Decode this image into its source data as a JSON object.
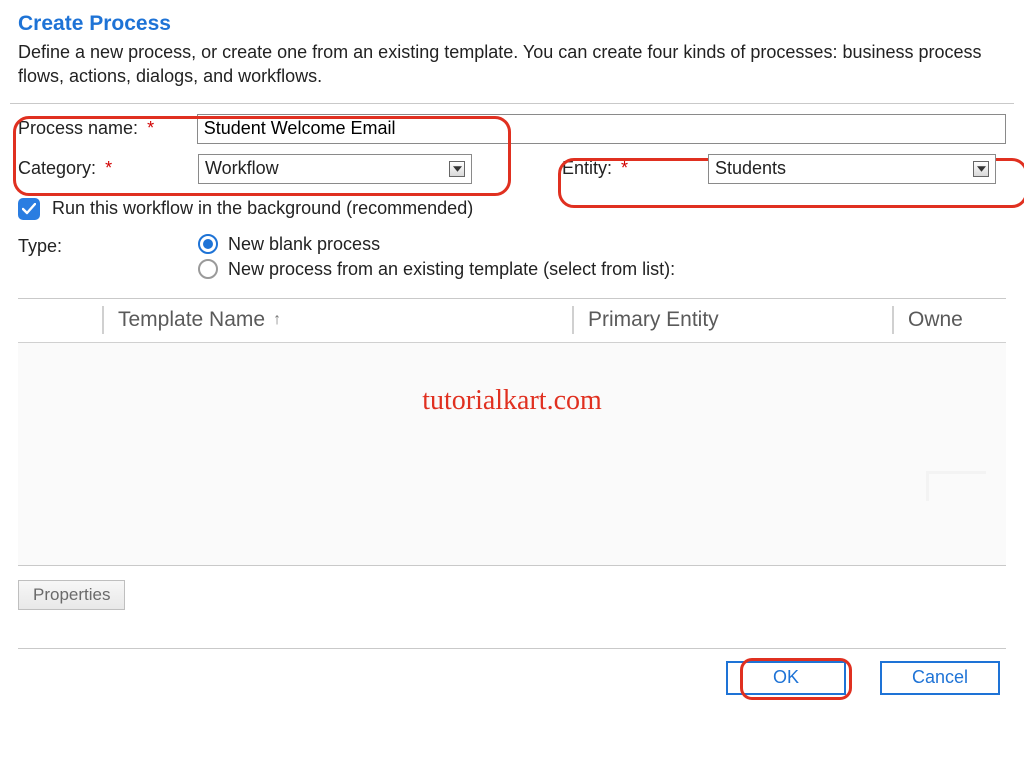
{
  "header": {
    "title": "Create Process",
    "description": "Define a new process, or create one from an existing template. You can create four kinds of processes: business process flows, actions, dialogs, and workflows."
  },
  "form": {
    "process_name_label": "Process name:",
    "process_name_value": "Student Welcome Email",
    "category_label": "Category:",
    "category_value": "Workflow",
    "entity_label": "Entity:",
    "entity_value": "Students",
    "required_mark": "*"
  },
  "options": {
    "background_label": "Run this workflow in the background (recommended)",
    "background_checked": true,
    "type_label": "Type:",
    "radio_blank": "New blank process",
    "radio_template": "New process from an existing template (select from list):",
    "radio_selected": "blank"
  },
  "grid": {
    "col_template": "Template Name",
    "sort_indicator": "↑",
    "col_primary": "Primary Entity",
    "col_owner": "Owne"
  },
  "watermark": "tutorialkart.com",
  "buttons": {
    "properties": "Properties",
    "ok": "OK",
    "cancel": "Cancel"
  }
}
